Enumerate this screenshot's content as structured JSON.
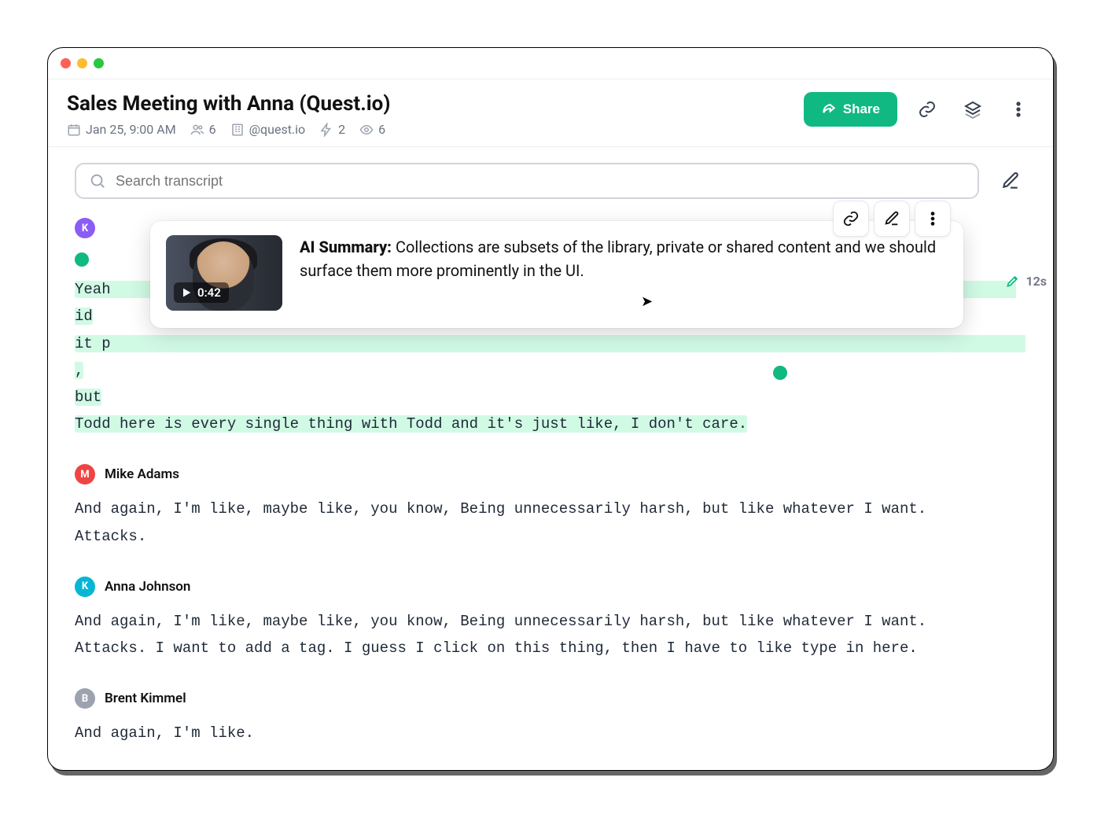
{
  "header": {
    "title": "Sales Meeting with Anna (Quest.io)",
    "date": "Jan 25, 9:00 AM",
    "attendees": "6",
    "domain": "@quest.io",
    "bolts": "2",
    "views": "6",
    "share_label": "Share"
  },
  "search": {
    "placeholder": "Search transcript"
  },
  "side_badge": {
    "label": "12s"
  },
  "popover": {
    "summary_label": "AI Summary:",
    "summary_text": "Collections are subsets of the library, private or shared content and we should surface them more prominently in the UI.",
    "clip_time": "0:42"
  },
  "transcript": [
    {
      "speaker_initial": "K",
      "speaker_name": "",
      "avatar_color": "purple",
      "lines": [
        "Yeah                                                                                                     id",
        "it p                                                                                                      ,",
        "but",
        "Todd here is every single thing with Todd and it's just like, I don't care."
      ],
      "selected": true
    },
    {
      "speaker_initial": "M",
      "speaker_name": "Mike Adams",
      "avatar_color": "red",
      "lines": [
        "And again, I'm like, maybe like, you know, Being unnecessarily harsh, but like whatever I want.",
        "Attacks."
      ]
    },
    {
      "speaker_initial": "K",
      "speaker_name": "Anna Johnson",
      "avatar_color": "cyan",
      "lines": [
        "And again, I'm like, maybe like, you know, Being unnecessarily harsh, but like whatever I want.",
        "Attacks. I want to add a tag. I guess I click on this thing, then I have to like type in here."
      ]
    },
    {
      "speaker_initial": "B",
      "speaker_name": "Brent Kimmel",
      "avatar_color": "gray",
      "lines": [
        "And again, I'm like."
      ]
    }
  ]
}
